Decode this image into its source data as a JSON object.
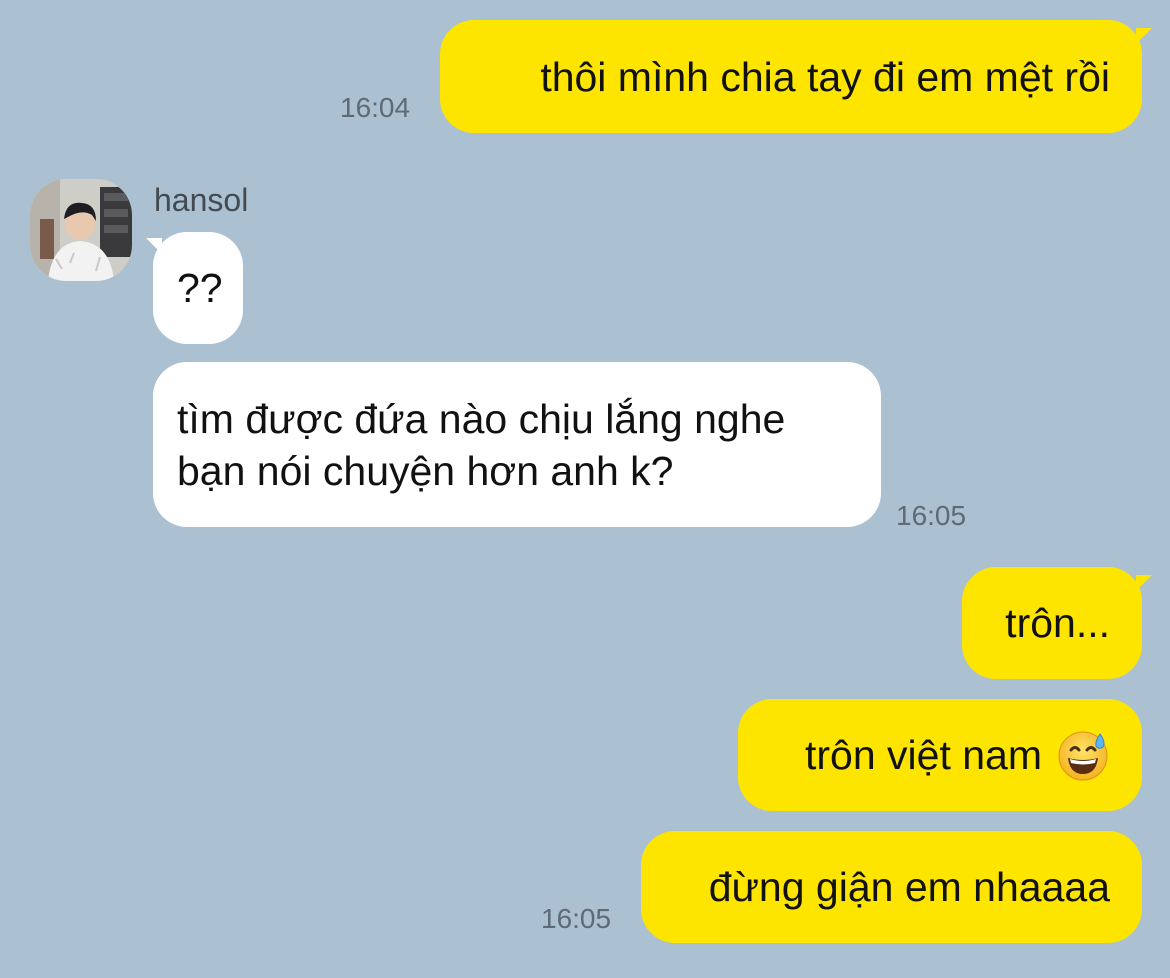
{
  "messages": [
    {
      "id": "m1",
      "direction": "outgoing",
      "text": "thôi mình chia tay đi em mệt rồi",
      "time": "16:04"
    },
    {
      "id": "m2",
      "direction": "incoming",
      "sender": "hansol",
      "text": "??"
    },
    {
      "id": "m3",
      "direction": "incoming",
      "lines": [
        "tìm được đứa nào chịu lắng nghe",
        "bạn nói chuyện hơn anh k?"
      ],
      "time": "16:05"
    },
    {
      "id": "m4",
      "direction": "outgoing",
      "text": "trôn..."
    },
    {
      "id": "m5",
      "direction": "outgoing",
      "text": "trôn việt nam",
      "emoji": "grinning-face-with-sweat-icon"
    },
    {
      "id": "m6",
      "direction": "outgoing",
      "text": "đừng giận em nhaaaa",
      "time": "16:05"
    }
  ],
  "colors": {
    "background": "#abc1d1",
    "outgoing_bubble": "#fee500",
    "incoming_bubble": "#ffffff",
    "timestamp": "#5f6a75"
  },
  "avatar": {
    "icon": "user-avatar"
  }
}
